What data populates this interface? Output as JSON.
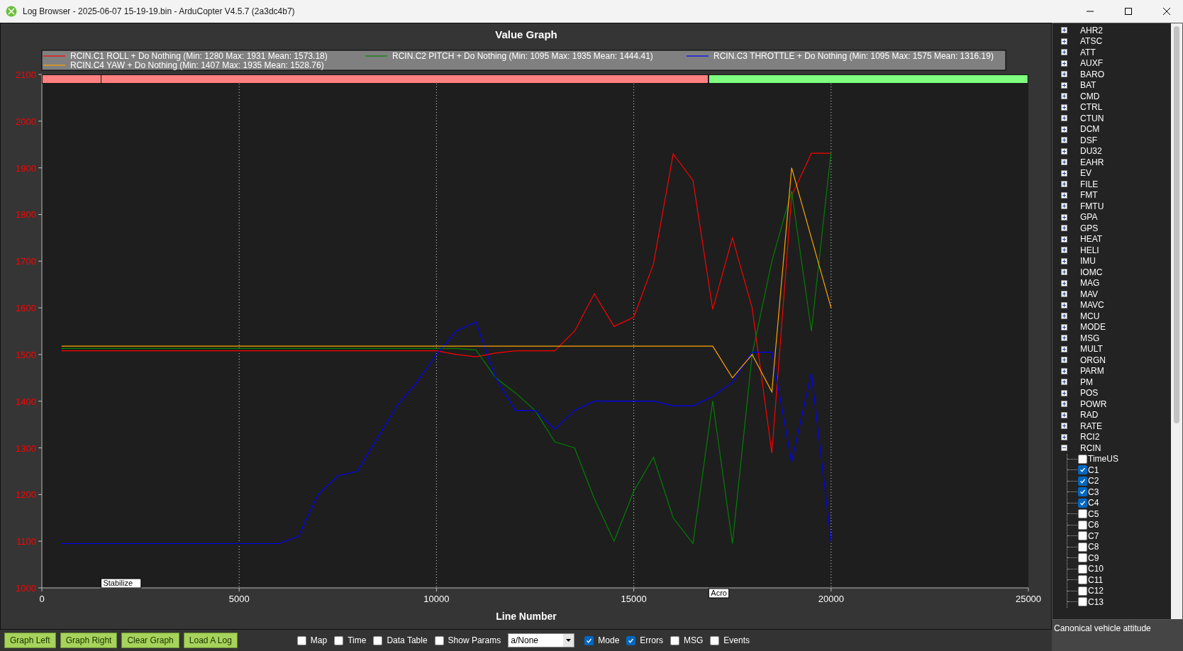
{
  "window": {
    "title": "Log Browser - 2025-06-07 15-19-19.bin - ArduCopter V4.5.7 (2a3dc4b7)"
  },
  "graph": {
    "chart_data": {
      "type": "line",
      "title": "Value Graph",
      "grid": true,
      "legend": "top",
      "xlabel": "Line Number",
      "xlim": [
        0,
        25000
      ],
      "ylim": [
        1000,
        2100
      ],
      "xticks": [
        0,
        5000,
        10000,
        15000,
        20000,
        25000
      ],
      "yticks": [
        1000,
        1100,
        1200,
        1300,
        1400,
        1500,
        1600,
        1700,
        1800,
        1900,
        2000,
        2100
      ],
      "x": [
        500,
        1000,
        1500,
        2000,
        2500,
        3000,
        3500,
        4000,
        4500,
        5000,
        5500,
        6000,
        6500,
        7000,
        7500,
        8000,
        8500,
        9000,
        9500,
        10000,
        10500,
        11000,
        11500,
        12000,
        12500,
        13000,
        13500,
        14000,
        14500,
        15000,
        15500,
        16000,
        16500,
        17000,
        17500,
        18000,
        18500,
        19000,
        19500,
        20000
      ],
      "series": [
        {
          "name": "RCIN.C1 ROLL + Do Nothing (Min: 1280 Max: 1931 Mean: 1573.18)",
          "color": "#ff0000",
          "values": [
            1508,
            1508,
            1508,
            1508,
            1508,
            1508,
            1508,
            1508,
            1508,
            1508,
            1508,
            1508,
            1508,
            1508,
            1508,
            1508,
            1508,
            1508,
            1508,
            1508,
            1500,
            1495,
            1503,
            1508,
            1508,
            1508,
            1550,
            1630,
            1560,
            1580,
            1694,
            1930,
            1873,
            1597,
            1750,
            1600,
            1289,
            1840,
            1931,
            1931
          ]
        },
        {
          "name": "RCIN.C2 PITCH + Do Nothing (Min: 1095 Max: 1935 Mean: 1444.41)",
          "color": "#008000",
          "values": [
            1513,
            1513,
            1513,
            1513,
            1513,
            1513,
            1513,
            1513,
            1513,
            1513,
            1513,
            1513,
            1513,
            1513,
            1513,
            1513,
            1513,
            1513,
            1513,
            1513,
            1513,
            1510,
            1450,
            1418,
            1380,
            1313,
            1300,
            1191,
            1100,
            1207,
            1280,
            1150,
            1095,
            1400,
            1095,
            1500,
            1700,
            1850,
            1550,
            1935
          ]
        },
        {
          "name": "RCIN.C3 THROTTLE + Do Nothing (Min: 1095 Max: 1575 Mean: 1316.19)",
          "color": "#0000ff",
          "values": [
            1095,
            1095,
            1095,
            1095,
            1095,
            1095,
            1095,
            1095,
            1095,
            1095,
            1095,
            1095,
            1110,
            1200,
            1240,
            1250,
            1320,
            1390,
            1440,
            1500,
            1550,
            1570,
            1450,
            1380,
            1380,
            1340,
            1380,
            1400,
            1400,
            1400,
            1400,
            1390,
            1390,
            1410,
            1440,
            1505,
            1505,
            1270,
            1460,
            1100
          ]
        },
        {
          "name": "RCIN.C4 YAW + Do Nothing (Min: 1407 Max: 1935 Mean: 1528.76)",
          "color": "#ffa500",
          "values": [
            1518,
            1518,
            1518,
            1518,
            1518,
            1518,
            1518,
            1518,
            1518,
            1518,
            1518,
            1518,
            1518,
            1518,
            1518,
            1518,
            1518,
            1518,
            1518,
            1518,
            1518,
            1518,
            1518,
            1518,
            1518,
            1518,
            1518,
            1518,
            1518,
            1518,
            1518,
            1518,
            1518,
            1518,
            1450,
            1500,
            1420,
            1900,
            1750,
            1600
          ]
        }
      ],
      "annotations": [
        "Stabilize",
        "Acro"
      ]
    }
  },
  "tree": {
    "items": [
      {
        "label": "AHR2",
        "expanded": false
      },
      {
        "label": "ATSC",
        "expanded": false
      },
      {
        "label": "ATT",
        "expanded": false
      },
      {
        "label": "AUXF",
        "expanded": false
      },
      {
        "label": "BARO",
        "expanded": false
      },
      {
        "label": "BAT",
        "expanded": false
      },
      {
        "label": "CMD",
        "expanded": false
      },
      {
        "label": "CTRL",
        "expanded": false
      },
      {
        "label": "CTUN",
        "expanded": false
      },
      {
        "label": "DCM",
        "expanded": false
      },
      {
        "label": "DSF",
        "expanded": false
      },
      {
        "label": "DU32",
        "expanded": false
      },
      {
        "label": "EAHR",
        "expanded": false
      },
      {
        "label": "EV",
        "expanded": false
      },
      {
        "label": "FILE",
        "expanded": false
      },
      {
        "label": "FMT",
        "expanded": false
      },
      {
        "label": "FMTU",
        "expanded": false
      },
      {
        "label": "GPA",
        "expanded": false
      },
      {
        "label": "GPS",
        "expanded": false
      },
      {
        "label": "HEAT",
        "expanded": false
      },
      {
        "label": "HELI",
        "expanded": false
      },
      {
        "label": "IMU",
        "expanded": false
      },
      {
        "label": "IOMC",
        "expanded": false
      },
      {
        "label": "MAG",
        "expanded": false
      },
      {
        "label": "MAV",
        "expanded": false
      },
      {
        "label": "MAVC",
        "expanded": false
      },
      {
        "label": "MCU",
        "expanded": false
      },
      {
        "label": "MODE",
        "expanded": false
      },
      {
        "label": "MSG",
        "expanded": false
      },
      {
        "label": "MULT",
        "expanded": false
      },
      {
        "label": "ORGN",
        "expanded": false
      },
      {
        "label": "PARM",
        "expanded": false
      },
      {
        "label": "PM",
        "expanded": false
      },
      {
        "label": "POS",
        "expanded": false
      },
      {
        "label": "POWR",
        "expanded": false
      },
      {
        "label": "RAD",
        "expanded": false
      },
      {
        "label": "RATE",
        "expanded": false
      },
      {
        "label": "RCI2",
        "expanded": false
      },
      {
        "label": "RCIN",
        "expanded": true,
        "children": [
          {
            "label": "TimeUS",
            "checked": false
          },
          {
            "label": "C1",
            "checked": true
          },
          {
            "label": "C2",
            "checked": true
          },
          {
            "label": "C3",
            "checked": true
          },
          {
            "label": "C4",
            "checked": true
          },
          {
            "label": "C5",
            "checked": false
          },
          {
            "label": "C6",
            "checked": false
          },
          {
            "label": "C7",
            "checked": false
          },
          {
            "label": "C8",
            "checked": false
          },
          {
            "label": "C9",
            "checked": false
          },
          {
            "label": "C10",
            "checked": false
          },
          {
            "label": "C11",
            "checked": false
          },
          {
            "label": "C12",
            "checked": false
          },
          {
            "label": "C13",
            "checked": false
          }
        ]
      }
    ]
  },
  "description": "Canonical vehicle attitude",
  "buttons": [
    "Graph Left",
    "Graph Right",
    "Clear Graph",
    "Load A Log"
  ],
  "options": [
    {
      "kind": "checkbox",
      "label": "Map",
      "checked": false
    },
    {
      "kind": "checkbox",
      "label": "Time",
      "checked": false
    },
    {
      "kind": "checkbox",
      "label": "Data Table",
      "checked": false
    },
    {
      "kind": "checkbox",
      "label": "Show Params",
      "checked": false
    },
    {
      "kind": "dropdown",
      "value": "a/None"
    },
    {
      "kind": "checkbox",
      "label": "Mode",
      "checked": true
    },
    {
      "kind": "checkbox",
      "label": "Errors",
      "checked": true
    },
    {
      "kind": "checkbox",
      "label": "MSG",
      "checked": false
    },
    {
      "kind": "checkbox",
      "label": "Events",
      "checked": false
    }
  ]
}
